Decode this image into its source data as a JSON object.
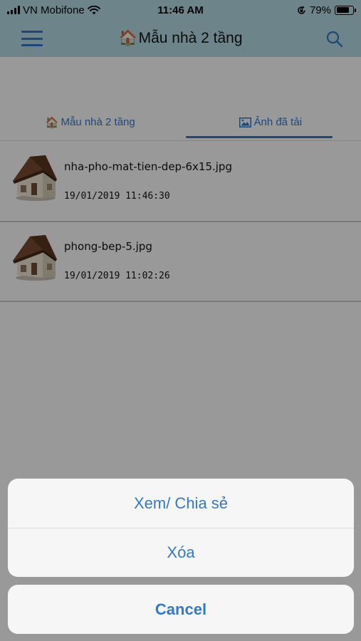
{
  "status_bar": {
    "carrier": "VN Mobifone",
    "time": "11:46 AM",
    "battery_percent": "79%",
    "battery_level": 0.79
  },
  "navbar": {
    "title_icon": "🏠",
    "title": "Mẫu nhà 2 tầng",
    "menu_icon": "hamburger-icon",
    "search_icon": "search-icon"
  },
  "tabs": [
    {
      "icon": "🏠",
      "label": "Mẫu nhà 2 tầng",
      "active": false
    },
    {
      "icon": "image-icon",
      "label": "Ảnh đã tải",
      "active": true
    }
  ],
  "files": [
    {
      "name": "nha-pho-mat-tien-dep-6x15.jpg",
      "date": "19/01/2019 11:46:30"
    },
    {
      "name": "phong-bep-5.jpg",
      "date": "19/01/2019 11:02:26"
    }
  ],
  "action_sheet": {
    "actions": [
      "Xem/ Chia sẻ",
      "Xóa"
    ],
    "cancel": "Cancel"
  },
  "colors": {
    "accent": "#3478c8",
    "header_bg": "#b7dde8"
  }
}
